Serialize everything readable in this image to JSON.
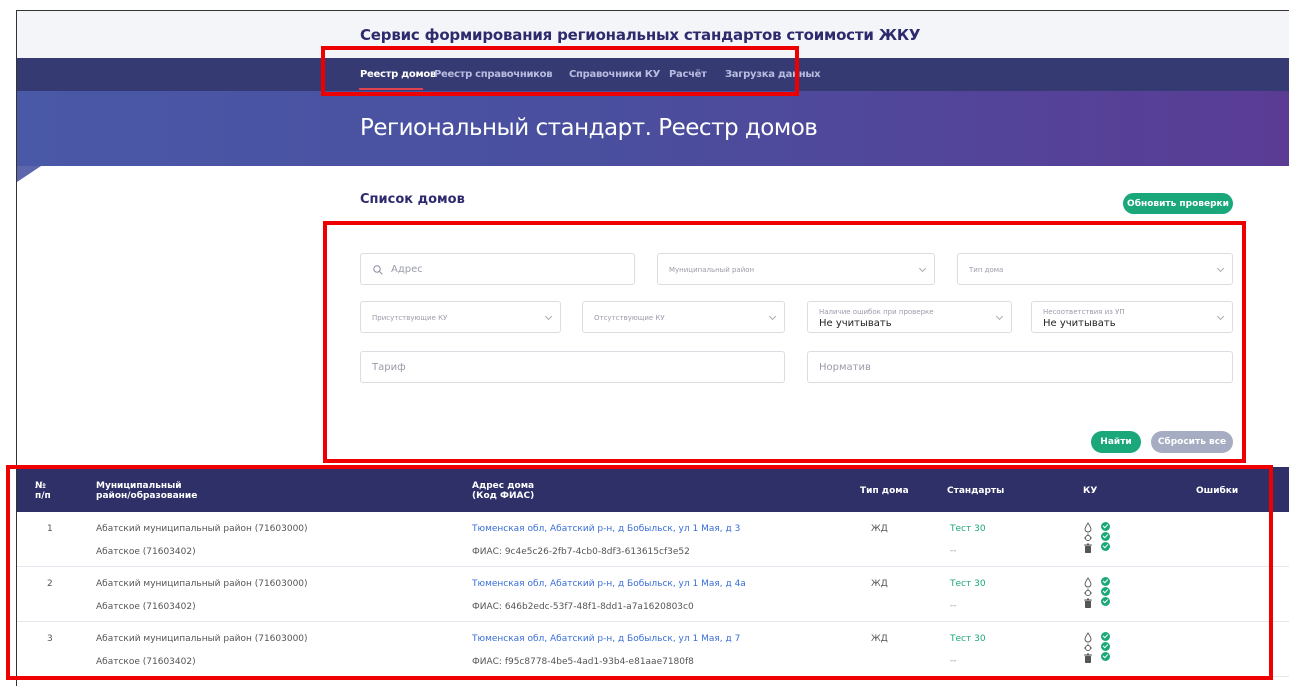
{
  "app": {
    "title": "Сервис формирования региональных стандартов стоимости ЖКУ"
  },
  "nav": {
    "items": [
      {
        "label": "Реестр домов",
        "active": true
      },
      {
        "label": "Реестр справочников",
        "active": false
      },
      {
        "label": "Справочники КУ",
        "active": false
      },
      {
        "label": "Расчёт",
        "active": false
      },
      {
        "label": "Загрузка данных",
        "active": false
      }
    ]
  },
  "hero": {
    "title": "Региональный стандарт. Реестр домов"
  },
  "section": {
    "title": "Список домов",
    "refresh_button": "Обновить проверки"
  },
  "filters": {
    "address_placeholder": "Адрес",
    "municipal_district_placeholder": "Муниципальный район",
    "house_type_placeholder": "Тип дома",
    "present_ku_placeholder": "Присутствующие КУ",
    "absent_ku_placeholder": "Отсутствующие КУ",
    "errors_label": "Наличие ошибок при проверке",
    "errors_value": "Не учитывать",
    "mismatch_label": "Несоответствия из УП",
    "mismatch_value": "Не учитывать",
    "tariff_placeholder": "Тариф",
    "norm_placeholder": "Норматив",
    "find_button": "Найти",
    "reset_button": "Сбросить все"
  },
  "table": {
    "headers": {
      "num_line1": "№",
      "num_line2": "п/п",
      "district_line1": "Муниципальный",
      "district_line2": "район/образование",
      "address_line1": "Адрес дома",
      "address_line2": "(Код ФИАС)",
      "house_type": "Тип дома",
      "standards": "Стандарты",
      "ku": "КУ",
      "errors": "Ошибки"
    },
    "rows": [
      {
        "num": "1",
        "district": "Абатский муниципальный район (71603000)",
        "settlement": "Абатское (71603402)",
        "address": "Тюменская обл, Абатский р-н, д Бобыльск, ул 1 Мая, д 3",
        "fias": "ФИАС: 9c4e5c26-2fb7-4cb0-8df3-613615cf3e52",
        "house_type": "ЖД",
        "standard": "Тест 30",
        "standard2": "--"
      },
      {
        "num": "2",
        "district": "Абатский муниципальный район (71603000)",
        "settlement": "Абатское (71603402)",
        "address": "Тюменская обл, Абатский р-н, д Бобыльск, ул 1 Мая, д 4а",
        "fias": "ФИАС: 646b2edc-53f7-48f1-8dd1-a7a1620803c0",
        "house_type": "ЖД",
        "standard": "Тест 30",
        "standard2": "--"
      },
      {
        "num": "3",
        "district": "Абатский муниципальный район (71603000)",
        "settlement": "Абатское (71603402)",
        "address": "Тюменская обл, Абатский р-н, д Бобыльск, ул 1 Мая, д 7",
        "fias": "ФИАС: f95c8778-4be5-4ad1-93b4-e81aae7180f8",
        "house_type": "ЖД",
        "standard": "Тест 30",
        "standard2": "--"
      }
    ],
    "ku_icons": [
      "water-drop-icon",
      "gas-icon",
      "trash-icon"
    ]
  },
  "colors": {
    "nav_bg": "#353a72",
    "accent_green": "#1aa87a",
    "link_blue": "#3a6fd8",
    "header_bg": "#2f3068",
    "highlight_red": "#ee0000"
  }
}
